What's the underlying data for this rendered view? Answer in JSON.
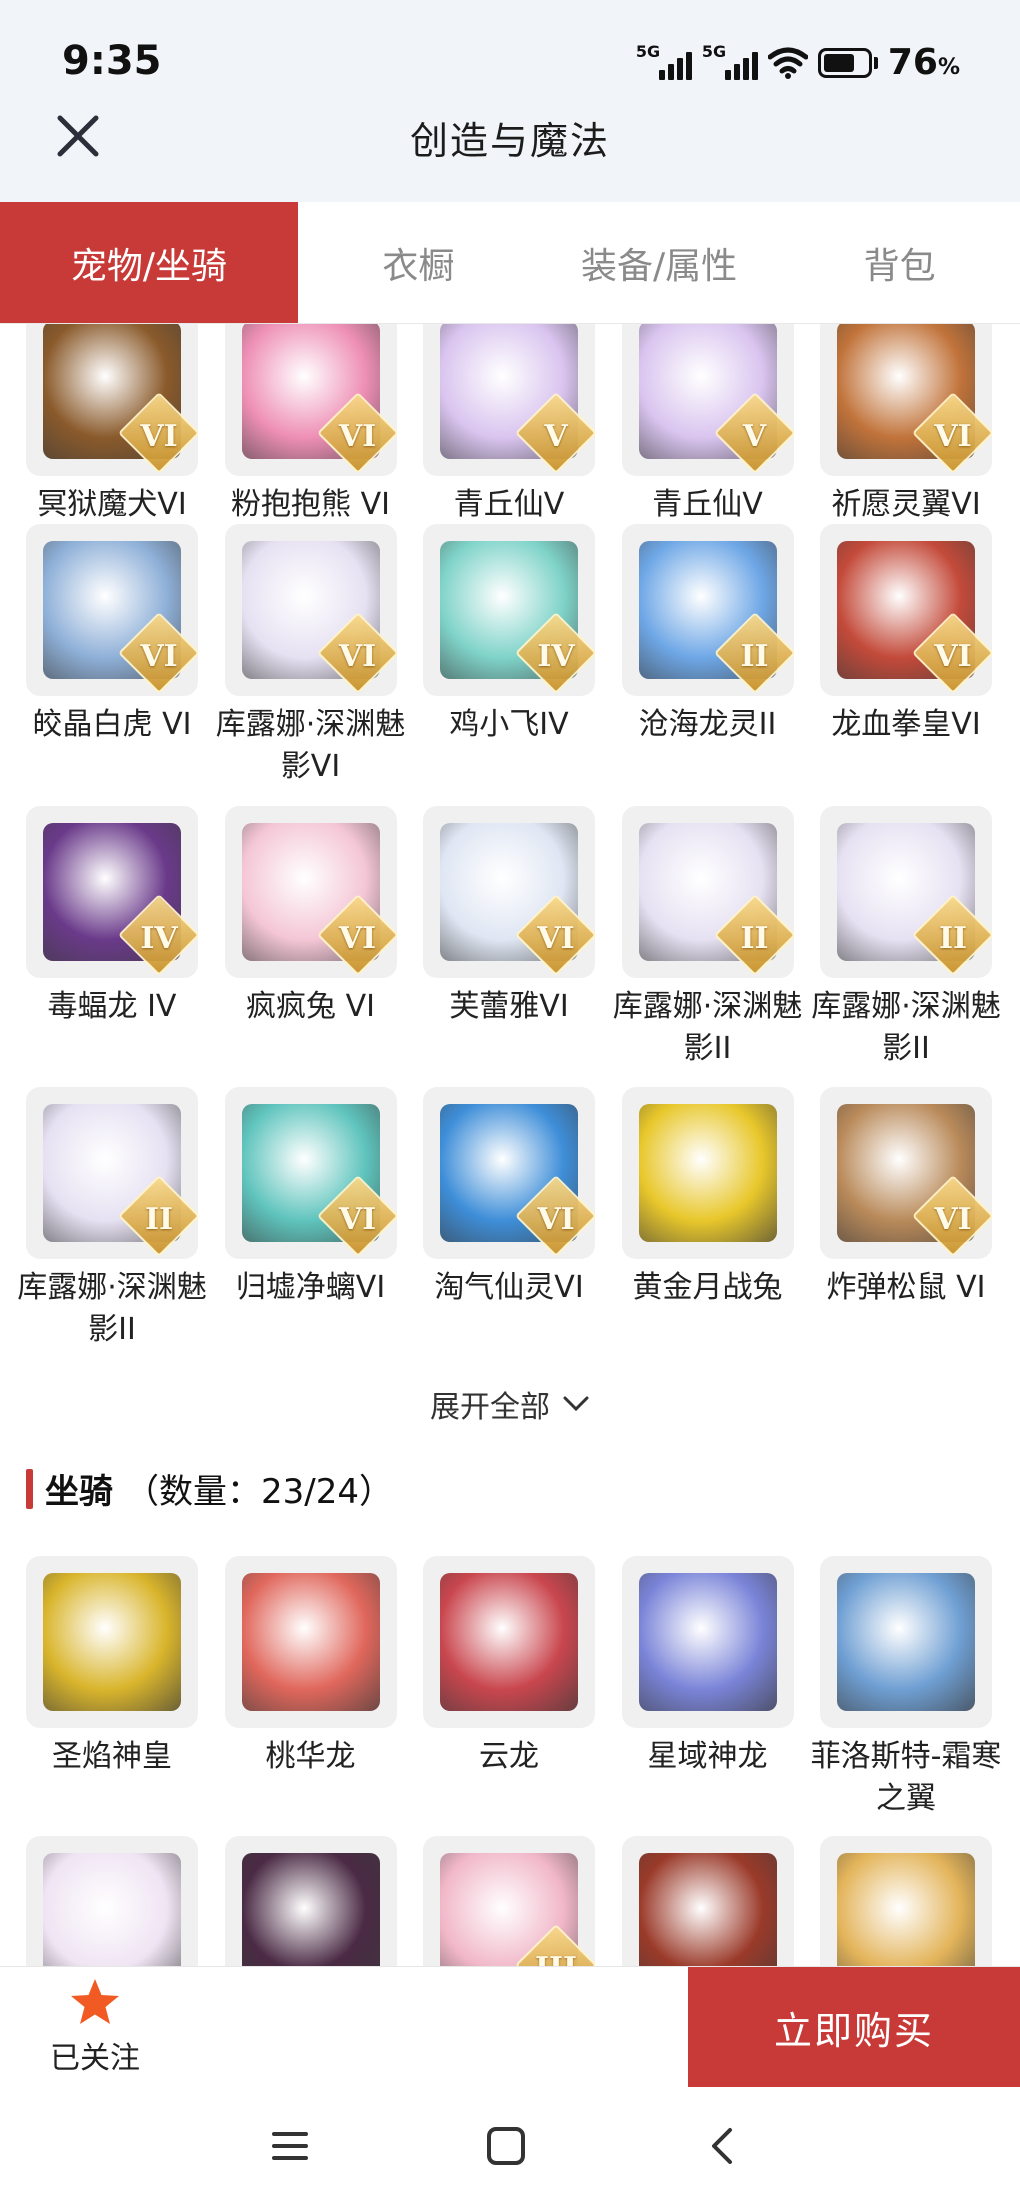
{
  "status_bar": {
    "time": "9:35",
    "network_1": "5G",
    "network_2": "5G",
    "battery_percent": "76",
    "battery_unit": "%"
  },
  "header": {
    "title": "创造与魔法",
    "close_icon": "close-icon"
  },
  "tabs": [
    {
      "label": "宠物/坐骑",
      "active": true
    },
    {
      "label": "衣橱",
      "active": false
    },
    {
      "label": "装备/属性",
      "active": false
    },
    {
      "label": "背包",
      "active": false
    }
  ],
  "pets": [
    {
      "name": "冥狱魔犬VI",
      "badge": "VI",
      "color": "#8a5a2b"
    },
    {
      "name": "粉抱抱熊 VI",
      "badge": "VI",
      "color": "#ee8fb5"
    },
    {
      "name": "青丘仙V",
      "badge": "V",
      "color": "#d9c4ef"
    },
    {
      "name": "青丘仙V",
      "badge": "V",
      "color": "#d9c4ef"
    },
    {
      "name": "祈愿灵翼VI",
      "badge": "VI",
      "color": "#c1733a"
    },
    {
      "name": "皎晶白虎 VI",
      "badge": "VI",
      "color": "#8fb0d8"
    },
    {
      "name": "库露娜·深渊魅影VI",
      "badge": "VI",
      "color": "#e6e1f2"
    },
    {
      "name": "鸡小飞IV",
      "badge": "IV",
      "color": "#7fd3c9"
    },
    {
      "name": "沧海龙灵II",
      "badge": "II",
      "color": "#6ea7e6"
    },
    {
      "name": "龙血拳皇VI",
      "badge": "VI",
      "color": "#c34a3a"
    },
    {
      "name": "毒蝠龙 IV",
      "badge": "IV",
      "color": "#6a3a8a"
    },
    {
      "name": "疯疯兔 VI",
      "badge": "VI",
      "color": "#f4c6d6"
    },
    {
      "name": "芙蕾雅VI",
      "badge": "VI",
      "color": "#dfe6f3"
    },
    {
      "name": "库露娜·深渊魅影II",
      "badge": "II",
      "color": "#e6e1f2"
    },
    {
      "name": "库露娜·深渊魅影II",
      "badge": "II",
      "color": "#e6e1f2"
    },
    {
      "name": "库露娜·深渊魅影II",
      "badge": "II",
      "color": "#e6e1f2"
    },
    {
      "name": "归墟净螭VI",
      "badge": "VI",
      "color": "#5fc4bd"
    },
    {
      "name": "淘气仙灵VI",
      "badge": "VI",
      "color": "#3e8ed8"
    },
    {
      "name": "黄金月战兔",
      "badge": "",
      "color": "#e8c72b"
    },
    {
      "name": "炸弹松鼠 VI",
      "badge": "VI",
      "color": "#b98a5a"
    }
  ],
  "expand_label": "展开全部",
  "mount_section": {
    "title": "坐骑",
    "count": "（数量：23/24）"
  },
  "mounts": [
    {
      "name": "圣焰神皇",
      "badge": "",
      "color": "#d9b52c"
    },
    {
      "name": "桃华龙",
      "badge": "",
      "color": "#e0675c"
    },
    {
      "name": "云龙",
      "badge": "",
      "color": "#c9464e"
    },
    {
      "name": "星域神龙",
      "badge": "",
      "color": "#7a84d8"
    },
    {
      "name": "菲洛斯特-霜寒之翼",
      "badge": "",
      "color": "#6f9fd3"
    },
    {
      "name": "",
      "badge": "",
      "color": "#efe4f3"
    },
    {
      "name": "",
      "badge": "",
      "color": "#4a2a44"
    },
    {
      "name": "",
      "badge": "III",
      "color": "#f1b7c9"
    },
    {
      "name": "",
      "badge": "",
      "color": "#9a3a2a"
    },
    {
      "name": "",
      "badge": "",
      "color": "#e3b45a"
    }
  ],
  "bottom_bar": {
    "follow_label": "已关注",
    "buy_label": "立即购买"
  },
  "accent_color": "#c83a37"
}
